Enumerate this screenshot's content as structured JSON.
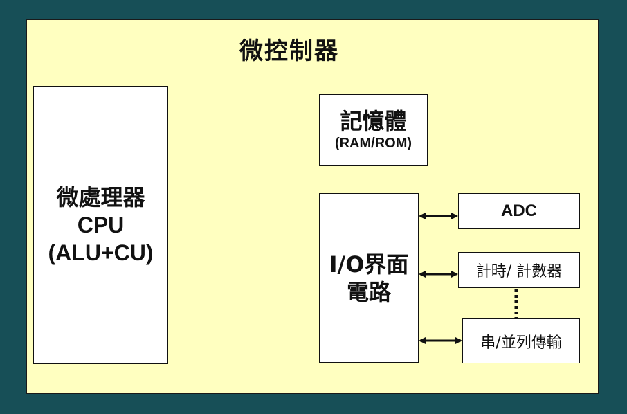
{
  "diagram": {
    "title": "微控制器",
    "cpu": {
      "line1": "微處理器",
      "line2": "CPU",
      "line3": "(ALU+CU)"
    },
    "memory": {
      "line1": "記憶體",
      "line2": "(RAM/ROM)"
    },
    "io": {
      "line1": "I/O界面",
      "line2": "電路"
    },
    "peripherals": {
      "adc": "ADC",
      "timer": "計時/ 計數器",
      "serial": "串/並列傳輸"
    }
  },
  "colors": {
    "background": "#174f57",
    "panel": "#ffffc0",
    "box": "#ffffff",
    "stroke": "#111111"
  }
}
